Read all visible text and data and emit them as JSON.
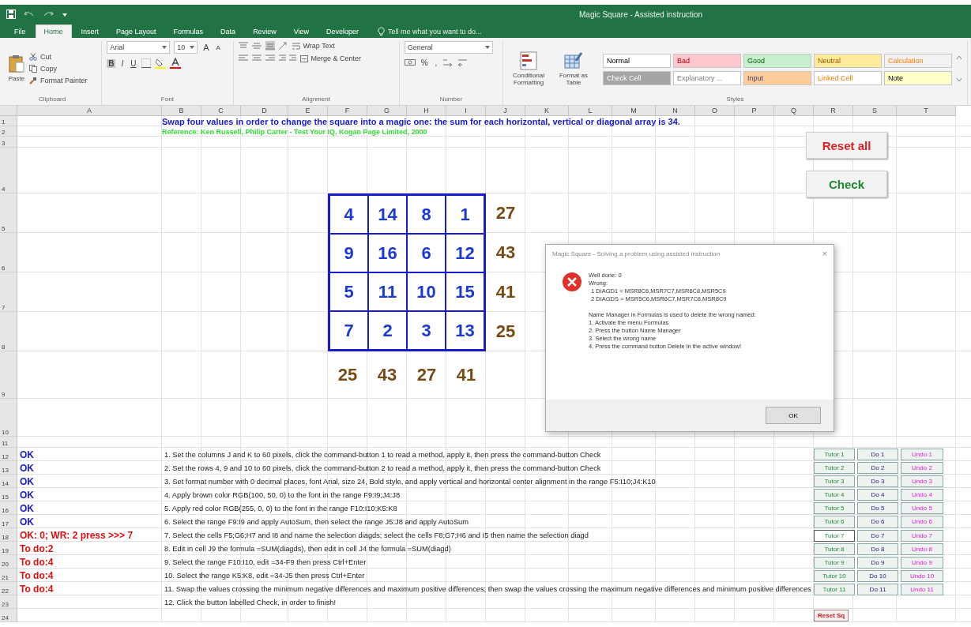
{
  "window": {
    "title": "Magic Square - Assisted instruction"
  },
  "tabs": [
    {
      "label": "File",
      "selected": false
    },
    {
      "label": "Home",
      "selected": true
    },
    {
      "label": "Insert",
      "selected": false
    },
    {
      "label": "Page Layout",
      "selected": false
    },
    {
      "label": "Formulas",
      "selected": false
    },
    {
      "label": "Data",
      "selected": false
    },
    {
      "label": "Review",
      "selected": false
    },
    {
      "label": "View",
      "selected": false
    },
    {
      "label": "Developer",
      "selected": false
    }
  ],
  "tell_me": {
    "placeholder": "Tell me what you want to do..."
  },
  "ribbon": {
    "clipboard": {
      "paste": "Paste",
      "cut": "Cut",
      "copy": "Copy",
      "format_painter": "Format Painter",
      "label": "Clipboard"
    },
    "font": {
      "name": "Arial",
      "size": "10",
      "grow": "A",
      "shrink": "A",
      "bold": "B",
      "italic": "I",
      "underline": "U",
      "label": "Font"
    },
    "alignment": {
      "wrap": "Wrap Text",
      "merge": "Merge & Center",
      "label": "Alignment"
    },
    "number": {
      "format": "General",
      "percent": "%",
      "comma": ",",
      "label": "Number"
    },
    "styles": {
      "conditional": "Conditional Formatting",
      "table": "Format as Table",
      "label": "Styles",
      "cells": [
        {
          "label": "Normal",
          "color": "#ffffff"
        },
        {
          "label": "Bad",
          "color": "#ffc7ce"
        },
        {
          "label": "Good",
          "color": "#c6efce"
        },
        {
          "label": "Neutral",
          "color": "#ffeb9c"
        },
        {
          "label": "Calculation",
          "color": "#f2f2f2"
        },
        {
          "label": "Check Cell",
          "color": "#a5a5a5"
        },
        {
          "label": "Explanatory ...",
          "color": "#ffffff"
        },
        {
          "label": "Input",
          "color": "#ffcc99"
        },
        {
          "label": "Linked Cell",
          "color": "#ffffff"
        },
        {
          "label": "Note",
          "color": "#ffffcc"
        }
      ]
    }
  },
  "columns": [
    "A",
    "B",
    "C",
    "D",
    "E",
    "F",
    "G",
    "H",
    "I",
    "J",
    "K",
    "L",
    "M",
    "N",
    "O",
    "P",
    "Q",
    "R",
    "S",
    "T"
  ],
  "row_numbers": [
    "1",
    "2",
    "3",
    "4",
    "5",
    "6",
    "7",
    "8",
    "9",
    "10",
    "11",
    "12",
    "13",
    "14",
    "15",
    "16",
    "17",
    "18",
    "19",
    "20",
    "21",
    "22",
    "23",
    "24"
  ],
  "sheet": {
    "heading": "Swap four values in order to change the square into a magic one: the sum for each horizontal, vertical or diagonal array is 34.",
    "reference": "Reference: Ken Russell, Philip Carter - Test Your IQ, Kogan Page Limited, 2000",
    "square": [
      [
        "4",
        "14",
        "8",
        "1"
      ],
      [
        "9",
        "16",
        "6",
        "12"
      ],
      [
        "5",
        "11",
        "10",
        "15"
      ],
      [
        "7",
        "2",
        "3",
        "13"
      ]
    ],
    "row_sums": [
      "27",
      "43",
      "41",
      "25"
    ],
    "column_sums": [
      "25",
      "43",
      "27",
      "41"
    ],
    "reset_all": "Reset all",
    "check": "Check",
    "status": [
      {
        "text": "OK",
        "kind": "ok"
      },
      {
        "text": "OK",
        "kind": "ok"
      },
      {
        "text": "OK",
        "kind": "ok"
      },
      {
        "text": "OK",
        "kind": "ok"
      },
      {
        "text": "OK",
        "kind": "ok"
      },
      {
        "text": "OK",
        "kind": "ok"
      },
      {
        "text": "OK: 0; WR: 2 press >>> 7",
        "kind": "wrong"
      },
      {
        "text": "To do:2",
        "kind": "todo"
      },
      {
        "text": "To do:4",
        "kind": "todo"
      },
      {
        "text": "To do:4",
        "kind": "todo"
      },
      {
        "text": "To do:4",
        "kind": "todo"
      }
    ],
    "instructions": [
      "1. Set the columns J and K to 60 pixels, click the command-button 1 to read a method, apply it, then press the command-button Check",
      "2. Set the rows 4, 9 and 10 to 60 pixels, click the command-button 2 to read a method, apply it, then press the command-button Check",
      "3. Set format number with 0 decimal places, font Arial, size 24, Bold style, and apply vertical and horizontal center alignment in the range F5:I10;J4:K10",
      "4. Apply brown color RGB(100, 50, 0) to the font in the range F9:I9;J4:J8",
      "5. Apply red color RGB(255, 0, 0) to the font in the range F10:I10;K5:K8",
      "6. Select the range F9:I9 and apply AutoSum, then select the range J5:J8 and apply AutoSum",
      "7. Select the cells F5;G6;H7 and I8 and name the selection diagds; select the cells F8;G7;H6 and I5 then name the selection diagd",
      "8. Edit in cell J9 the formula =SUM(diagds), then edit in cell J4 the formula =SUM(diagd)",
      "9. Select the range F10:I10, edit =34-F9 then press Ctrl+Enter",
      "10. Select the range K5:K8, edit =34-J5 then press Ctrl+Enter",
      "11. Swap the values crossing the minimum negative differences and maximum positive differences; then swap the values crossing the maximum negative differences and minimum positive differences",
      "12. Click the button labelled Check, in order to finish!"
    ],
    "tutor_panel": [
      {
        "tutor": "Tutor 1",
        "do": "Do 1",
        "undo": "Undo 1",
        "selected": false
      },
      {
        "tutor": "Tutor 2",
        "do": "Do 2",
        "undo": "Undo 2",
        "selected": false
      },
      {
        "tutor": "Tutor 3",
        "do": "Do 3",
        "undo": "Undo 3",
        "selected": false
      },
      {
        "tutor": "Tutor 4",
        "do": "Do 4",
        "undo": "Undo 4",
        "selected": false
      },
      {
        "tutor": "Tutor 5",
        "do": "Do 5",
        "undo": "Undo 5",
        "selected": false
      },
      {
        "tutor": "Tutor 6",
        "do": "Do 6",
        "undo": "Undo 6",
        "selected": false
      },
      {
        "tutor": "Tutor 7",
        "do": "Do 7",
        "undo": "Undo 7",
        "selected": true
      },
      {
        "tutor": "Tutor 8",
        "do": "Do 8",
        "undo": "Undo 8",
        "selected": false
      },
      {
        "tutor": "Tutor 9",
        "do": "Do 9",
        "undo": "Undo 9",
        "selected": false
      },
      {
        "tutor": "Tutor 10",
        "do": "Do 10",
        "undo": "Undo 10",
        "selected": false
      },
      {
        "tutor": "Tutor 11",
        "do": "Do 11",
        "undo": "Undo 11",
        "selected": false
      }
    ],
    "reset_sq": "Reset Sq"
  },
  "dialog": {
    "title": "Magic Square - Solving a problem using assisted instruction",
    "close": "×",
    "result": "Well done: 0",
    "wrong_label": "Wrong:",
    "wrong": [
      "1 DIAGD1 = MSR8C6,MSR7C7,MSR6C8,MSR5C9",
      "2 DIAGDS = MSR5C6,MSR6C7,MSR7C8,MSR8C9"
    ],
    "note": "Name Manager in Formulas is used to delete the wrong named:",
    "steps": [
      "1. Activate the menu Formulas",
      "2. Press the button Name Manager",
      "3. Select the wrong name",
      "4. Press the command button Delete in the active window!"
    ],
    "ok": "OK"
  }
}
